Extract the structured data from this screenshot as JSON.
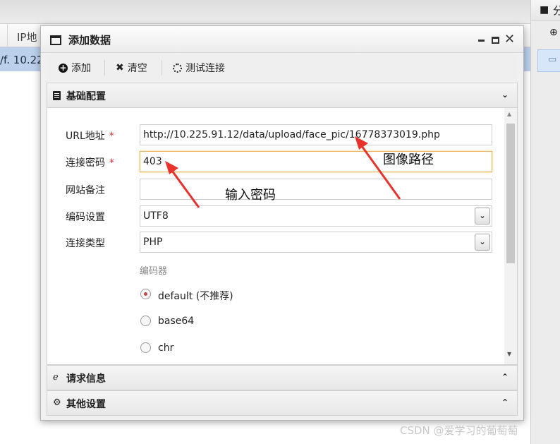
{
  "background": {
    "column_header": "IP地",
    "row_text": "/f. 10.22",
    "right_tab": "分",
    "right_tab_icon": "folder-icon",
    "right_add_icon": "plus-circle-icon",
    "right_row_icon": "folder-open-icon"
  },
  "dialog": {
    "title": "添加数据",
    "window_controls": [
      "minimize-icon",
      "maximize-icon",
      "close-icon"
    ]
  },
  "toolbar": {
    "add_label": "添加",
    "clear_label": "清空",
    "test_label": "测试连接"
  },
  "sections": {
    "basic": "基础配置",
    "request": "请求信息",
    "other": "其他设置"
  },
  "form": {
    "url_label": "URL地址",
    "url_value": "http://10.225.91.12/data/upload/face_pic/16778373019.php",
    "password_label": "连接密码",
    "password_value": "403",
    "note_label": "网站备注",
    "note_value": "",
    "encoding_label": "编码设置",
    "encoding_value": "UTF8",
    "type_label": "连接类型",
    "type_value": "PHP",
    "required_mark": "*",
    "encoder_label": "编码器",
    "encoders": [
      {
        "label": "default (不推荐)",
        "checked": true
      },
      {
        "label": "base64",
        "checked": false
      },
      {
        "label": "chr",
        "checked": false
      }
    ]
  },
  "annotations": {
    "image_path": "图像路径",
    "enter_password": "输入密码",
    "arrow_color": "#e8322c"
  },
  "watermark": "CSDN @爱学习的葡萄萄"
}
